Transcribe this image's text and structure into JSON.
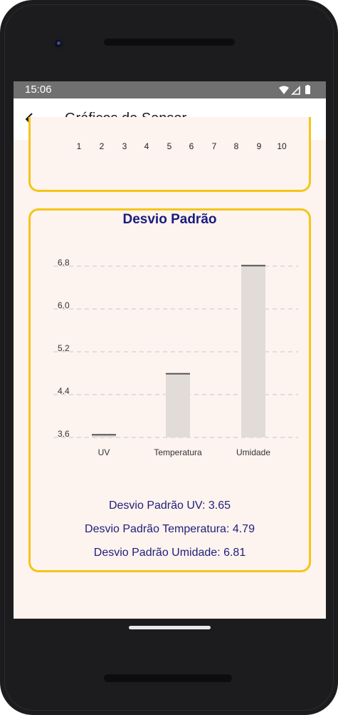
{
  "status_bar": {
    "time": "15:06"
  },
  "app_bar": {
    "title": "Gráficos de Sensor"
  },
  "previous_chart": {
    "x_ticks": [
      "1",
      "2",
      "3",
      "4",
      "5",
      "6",
      "7",
      "8",
      "9",
      "10"
    ]
  },
  "std_dev_card": {
    "title": "Desvio Padrão",
    "lines": [
      "Desvio Padrão UV: 3.65",
      "Desvio Padrão Temperatura: 4.79",
      "Desvio Padrão Umidade: 6.81"
    ]
  },
  "chart_data": {
    "type": "bar",
    "title": "Desvio Padrão",
    "categories": [
      "UV",
      "Temperatura",
      "Umidade"
    ],
    "values": [
      3.65,
      4.79,
      6.81
    ],
    "y_ticks": [
      "3.6",
      "4.4",
      "5.2",
      "6.0",
      "6.8"
    ],
    "ylim": [
      3.6,
      6.8
    ],
    "grid": true,
    "colors": {
      "bar": "#e2dcd9",
      "bar_top": "#555555",
      "grid": "#c8c8c8"
    }
  },
  "colors": {
    "card_border": "#f5c518",
    "title": "#1a1a7e",
    "screen_bg": "#fdf3ef"
  }
}
